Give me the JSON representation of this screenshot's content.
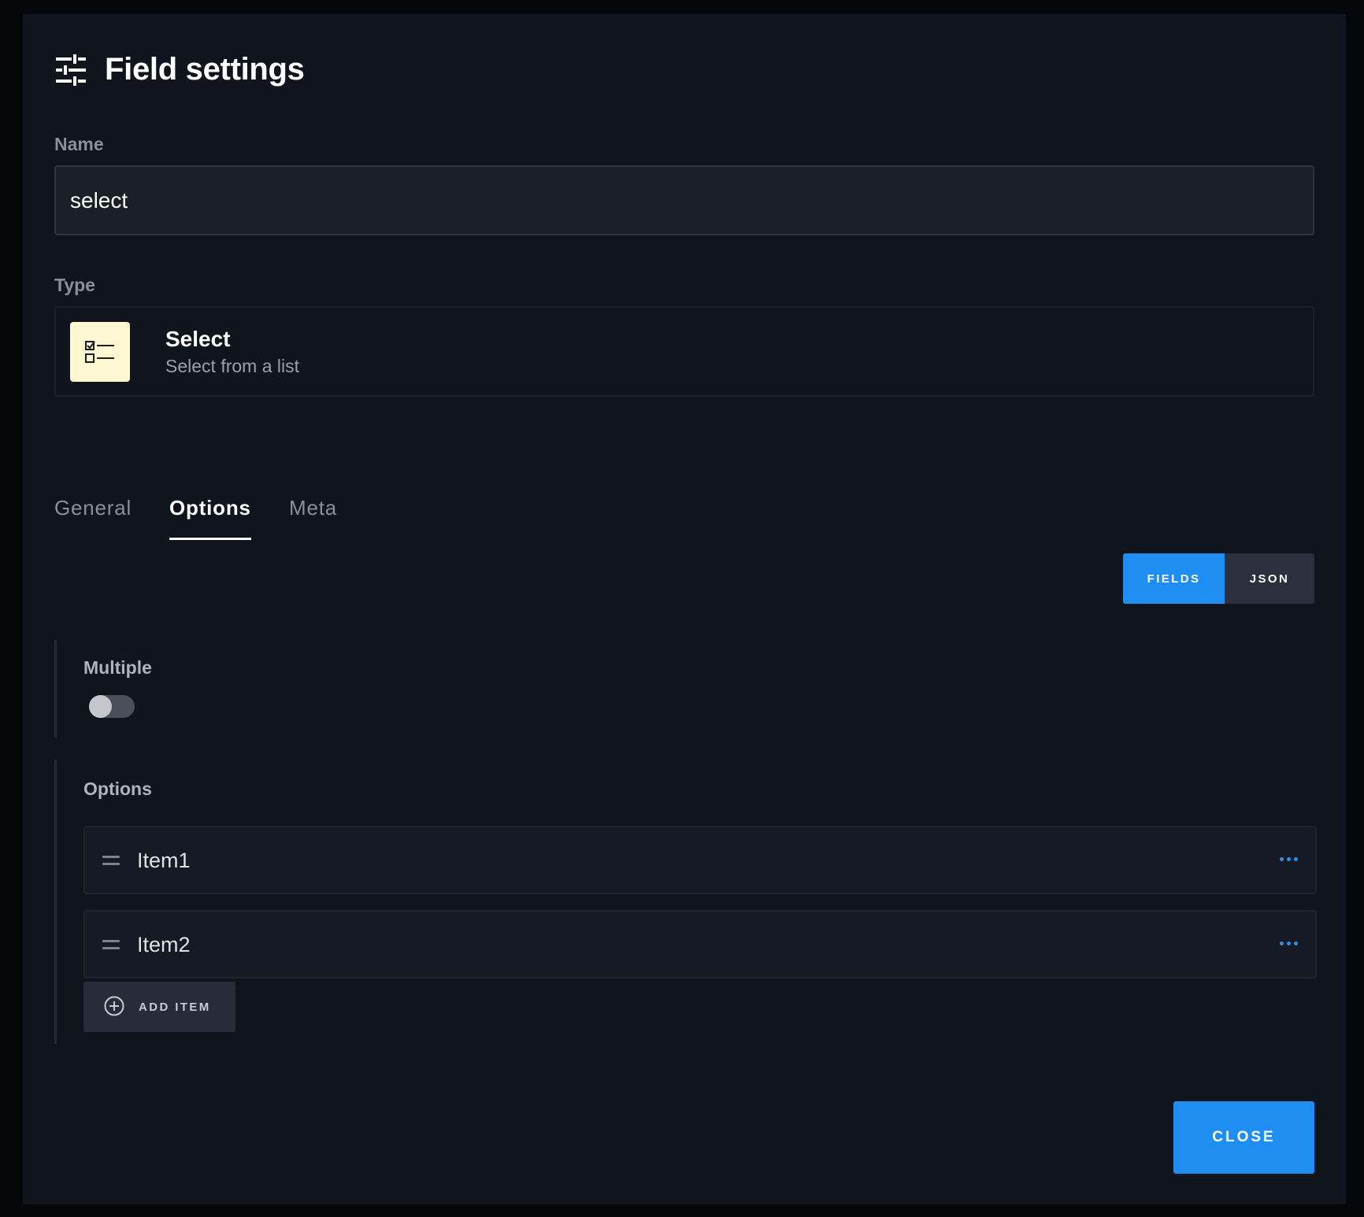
{
  "dialog": {
    "title": "Field settings",
    "title_icon": "sliders-icon",
    "close_label": "CLOSE"
  },
  "name_field": {
    "label": "Name",
    "value": "select"
  },
  "type_field": {
    "label": "Type",
    "icon": "checklist-icon",
    "name": "Select",
    "description": "Select from a list"
  },
  "tabs": [
    {
      "label": "General",
      "active": false
    },
    {
      "label": "Options",
      "active": true
    },
    {
      "label": "Meta",
      "active": false
    }
  ],
  "mode_toggle": {
    "fields_label": "FIELDS",
    "json_label": "JSON",
    "selected": "FIELDS"
  },
  "multiple": {
    "label": "Multiple",
    "enabled": false
  },
  "options": {
    "label": "Options",
    "items": [
      {
        "label": "Item1"
      },
      {
        "label": "Item2"
      }
    ],
    "add_label": "ADD ITEM"
  },
  "colors": {
    "accent": "#1e8ef2",
    "background": "#10141c",
    "type_icon_bg": "#fdf8d2"
  }
}
